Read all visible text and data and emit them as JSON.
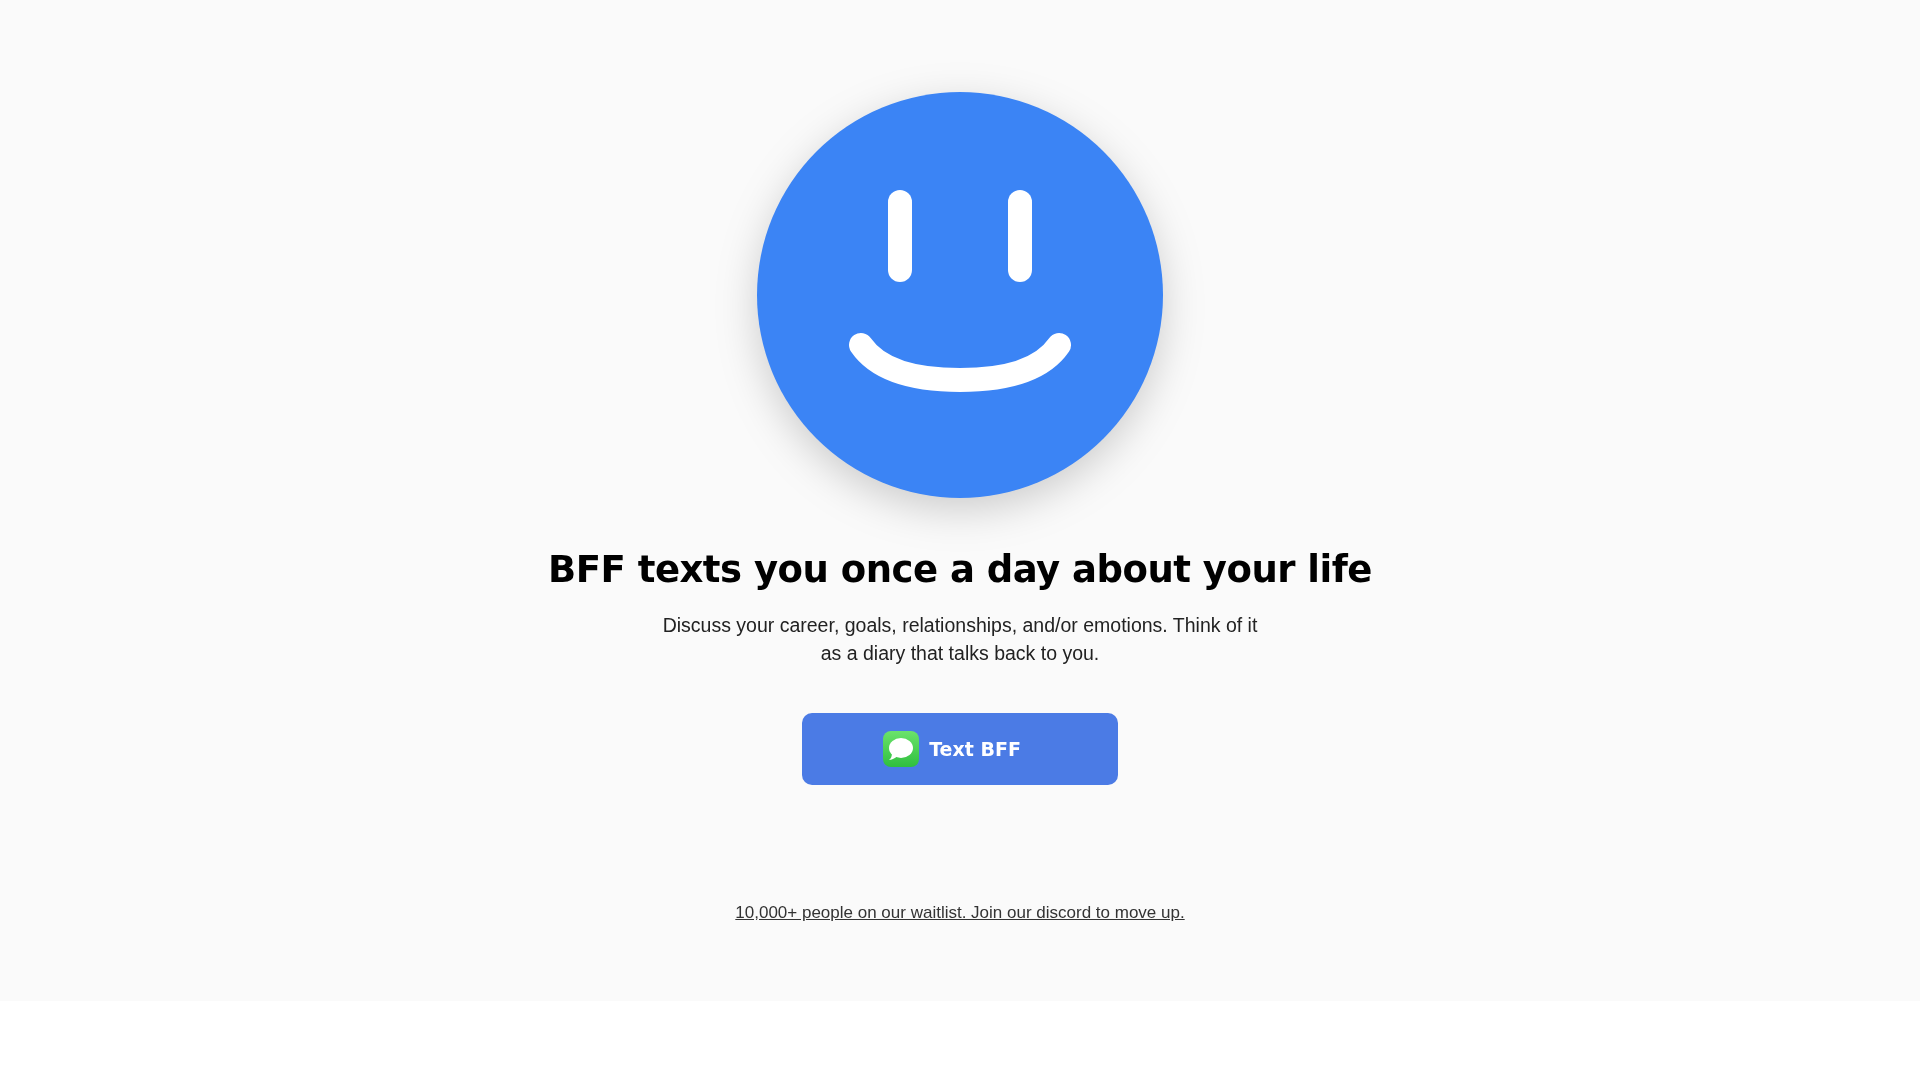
{
  "hero": {
    "heading": "BFF texts you once a day about your life",
    "description": "Discuss your career, goals, relationships, and/or emotions. Think of it as a diary that talks back to you."
  },
  "cta_button": {
    "label": "Text BFF"
  },
  "footer_link": "10,000+ people on our waitlist. Join our discord to move up."
}
